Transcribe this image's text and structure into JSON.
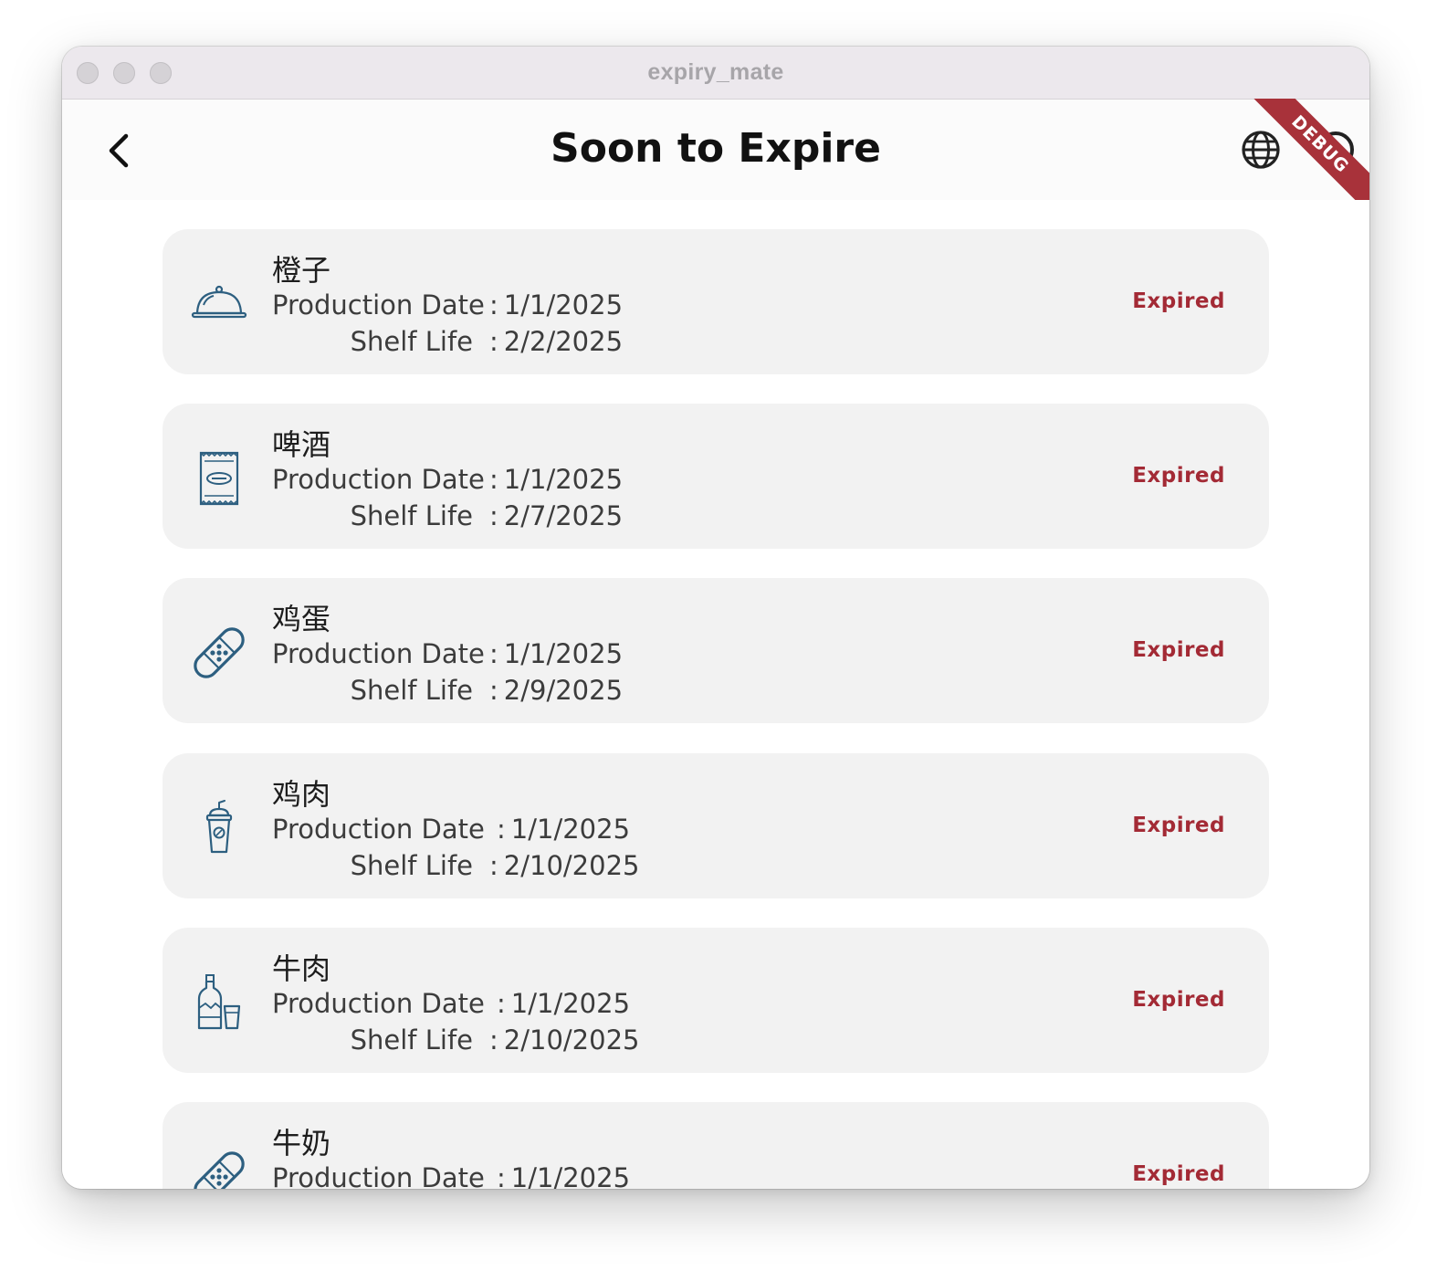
{
  "window": {
    "title": "expiry_mate"
  },
  "appbar": {
    "title": "Soon to Expire",
    "debug_label": "DEBUG"
  },
  "colors": {
    "accent_icon": "#2d5f80",
    "status_expired": "#a32a35",
    "card_bg": "#f2f2f2"
  },
  "items": [
    {
      "name": "橙子",
      "icon": "food-cloche-icon",
      "production_label": "Production Date",
      "production_date": "1/1/2025",
      "shelf_label": "Shelf Life",
      "shelf_life": "2/2/2025",
      "status": "Expired"
    },
    {
      "name": "啤酒",
      "icon": "snack-bag-icon",
      "production_label": "Production Date",
      "production_date": "1/1/2025",
      "shelf_label": "Shelf Life",
      "shelf_life": "2/7/2025",
      "status": "Expired"
    },
    {
      "name": "鸡蛋",
      "icon": "bandage-icon",
      "production_label": "Production Date",
      "production_date": "1/1/2025",
      "shelf_label": "Shelf Life",
      "shelf_life": "2/9/2025",
      "status": "Expired"
    },
    {
      "name": "鸡肉",
      "icon": "drink-cup-icon",
      "production_label": "Production Date",
      "production_date": "1/1/2025",
      "shelf_label": "Shelf Life",
      "shelf_life": "2/10/2025",
      "status": "Expired"
    },
    {
      "name": "牛肉",
      "icon": "bottle-glass-icon",
      "production_label": "Production Date",
      "production_date": "1/1/2025",
      "shelf_label": "Shelf Life",
      "shelf_life": "2/10/2025",
      "status": "Expired"
    },
    {
      "name": "牛奶",
      "icon": "bandage-icon",
      "production_label": "Production Date",
      "production_date": "1/1/2025",
      "status": "Expired"
    }
  ]
}
